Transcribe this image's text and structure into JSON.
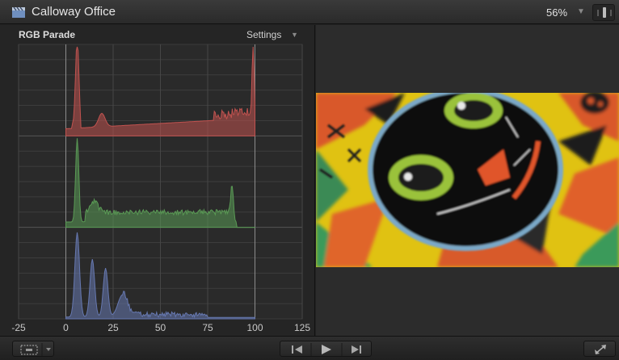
{
  "window": {
    "title": "Calloway Office",
    "zoom": "56%",
    "icons": {
      "app": "clapperboard-icon",
      "zoom_menu": "chevron-down-icon",
      "view_switch": "view-switch-icon"
    }
  },
  "scope": {
    "title": "RGB Parade",
    "settings_label": "Settings",
    "x_ticks": [
      "-25",
      "0",
      "25",
      "50",
      "75",
      "100",
      "125"
    ],
    "x_tick_values": [
      -25,
      0,
      25,
      50,
      75,
      100,
      125
    ],
    "x_range": [
      -25,
      125
    ],
    "channels": [
      {
        "name": "red",
        "color": "#c0524f"
      },
      {
        "name": "green",
        "color": "#5a9a55"
      },
      {
        "name": "blue",
        "color": "#6678b0"
      }
    ]
  },
  "viewer": {
    "content": "close-up photo of a painted black cat face on a yellow and orange patterned board"
  },
  "controls": {
    "icons": {
      "view_options": "viewer-options-icon",
      "view_options_menu": "chevron-down-icon",
      "previous": "skip-back-icon",
      "play": "play-icon",
      "next": "skip-forward-icon",
      "fullscreen": "fullscreen-icon"
    }
  },
  "colors": {
    "background": "#232323",
    "graticule": "#4a4a4a",
    "reference_line": "#8c8c8c"
  }
}
